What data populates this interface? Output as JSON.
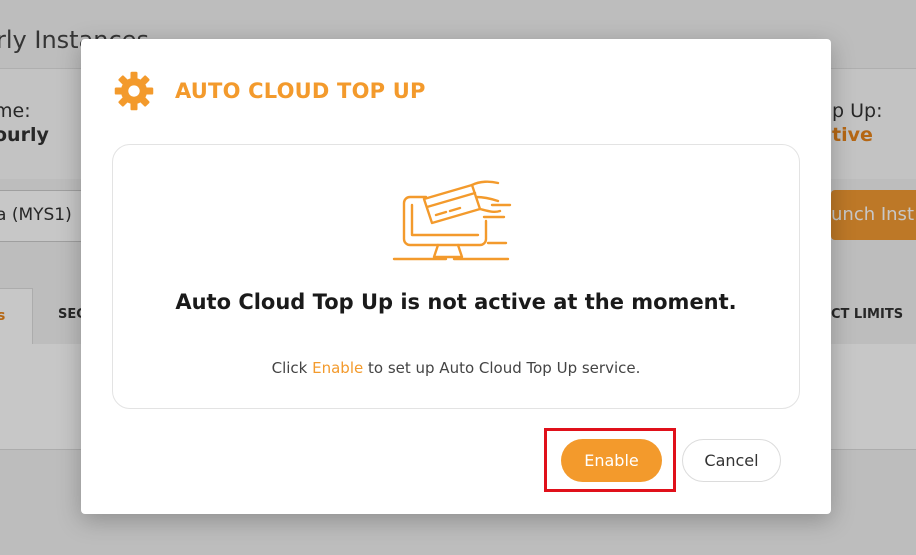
{
  "background": {
    "page_title": "rly Instances",
    "plan_label": "me:",
    "plan_value": "ourly",
    "topup_label": "p Up:",
    "topup_value": "tive",
    "region_select_value": "a (MYS1)",
    "launch_button_label": "unch Inst",
    "active_tab_label": "s",
    "tab_security_label": "SEC",
    "tab_limits_label": "CT LIMITS"
  },
  "modal": {
    "title": "AUTO CLOUD TOP UP",
    "header_icon": "gear-icon",
    "illustration_icon": "computer-card-icon",
    "heading": "Auto Cloud Top Up is not active at the moment.",
    "text_prefix": "Click ",
    "text_link": "Enable",
    "text_suffix": " to set up Auto Cloud Top Up service.",
    "enable_label": "Enable",
    "cancel_label": "Cancel"
  },
  "colors": {
    "accent": "#f39a2c",
    "highlight_border": "#e0101a"
  }
}
